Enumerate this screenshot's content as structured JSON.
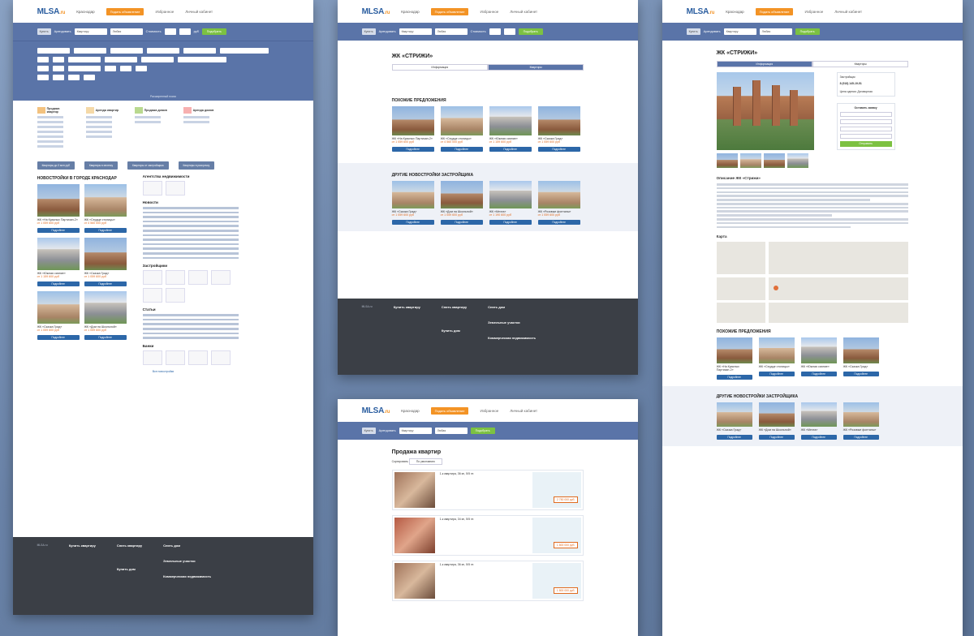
{
  "header": {
    "logo_main": "MLSA",
    "logo_tld": ".ru",
    "city": "Краснодар",
    "submit_ad": "Подать объявление",
    "favorites": "Избранное",
    "cabinet": "Личный кабинет"
  },
  "search": {
    "buy": "Купить",
    "rent": "Арендовать",
    "type": "Квартиру",
    "any": "Любая",
    "cost": "Стоимость",
    "currency": "руб",
    "find": "Подобрать",
    "extended": "Расширенный поиск"
  },
  "catalog": [
    {
      "title": "Продажа квартир"
    },
    {
      "title": "Аренда квартир"
    },
    {
      "title": "Продажа домов"
    },
    {
      "title": "Аренда домов"
    },
    {
      "title": "Земельные участки"
    },
    {
      "title": "Коммерческая недвижимость"
    }
  ],
  "quick_buttons": [
    "Квартиры до 3 млн руб",
    "Квартиры в ипотеку",
    "Квартиры от застройщика",
    "Квартиры в рассрочку"
  ],
  "left_panel": {
    "new_buildings_title": "Новостройки в городе Краснодар",
    "agencies_title": "Агентства недвижимости",
    "news_title": "Новости",
    "developers_title": "Застройщики",
    "articles_title": "Статьи",
    "banks_title": "Банки",
    "all_new_buildings": "Все новостройки"
  },
  "cards": [
    {
      "name": "ЖК «На Красных Партизан-2»",
      "price": "от 1 059 600 руб",
      "btn": "Подробнее"
    },
    {
      "name": "ЖК «Сердце столицы»",
      "price": "от 4 560 000 руб",
      "btn": "Подробнее"
    },
    {
      "name": "ЖК «Южная сияние»",
      "price": "от 1 159 600 руб",
      "btn": "Подробнее"
    },
    {
      "name": "ЖК «Сказка Град»",
      "price": "от 1 059 600 руб",
      "btn": "Подробнее"
    }
  ],
  "other_cards": [
    {
      "name": "ЖК «Сказка Град»",
      "price": "от 1 059 600 руб",
      "btn": "Подробнее"
    },
    {
      "name": "ЖК «Дом на Школьной»",
      "price": "от 1 059 600 руб",
      "btn": "Подробнее"
    },
    {
      "name": "ЖК «Мечта»",
      "price": "от 1 190 600 руб",
      "btn": "Подробнее"
    },
    {
      "name": "ЖК «Розовые фонтаны»",
      "price": "от 1 059 600 руб",
      "btn": "Подробнее"
    }
  ],
  "detail": {
    "title": "ЖК «СТРИЖИ»",
    "tab_info": "Информация",
    "tab_flats": "Квартиры",
    "similar": "Похожие предложения",
    "other": "Другие новостройки застройщика",
    "description_title": "Описание ЖК «Стрижи»",
    "map_title": "Карта",
    "developer_label": "Застройщик",
    "phone": "8 (918) 145-19-51",
    "request": "Оставить заявку",
    "send": "Отправить",
    "price_label": "Цена сделки:",
    "price_value": "Договорная"
  },
  "listing_page": {
    "title": "Продажа квартир",
    "sort_label": "Сортировать",
    "sort_value": "По умолчанию",
    "items": [
      {
        "desc": "1-к квартира, 36 м², 5/5 эт.",
        "price": "2 750 000 руб."
      },
      {
        "desc": "1-к квартира, 34 м², 5/5 эт.",
        "price": "1 800 000 руб."
      },
      {
        "desc": "1-к квартира, 36 м², 5/5 эт.",
        "price": "1 800 000 руб."
      },
      {
        "desc": "1-к квартира, 42 м², 5/5 эт.",
        "price": "1 800 000 руб."
      }
    ]
  },
  "footer": {
    "logo": "MLSA.ru",
    "col1": "Купить квартиру",
    "col2": "Снять квартиру",
    "col3": "Снять дом",
    "col4": "Земельные участки",
    "col5": "Коммерческая недвижимость",
    "col6": "Купить дом"
  }
}
